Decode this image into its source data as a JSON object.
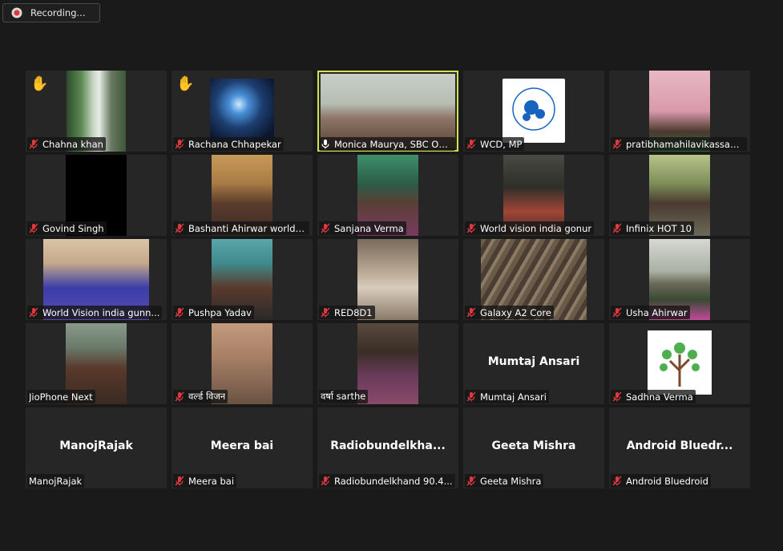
{
  "recording": {
    "label": "Recording...",
    "icon": "recording-icon"
  },
  "colors": {
    "background": "#1a1a1a",
    "tile": "#262626",
    "active_border": "#d4e157",
    "muted_icon": "#e0383e"
  },
  "participants": [
    {
      "name": "Chahna khan",
      "muted": true,
      "raised_hand": true
    },
    {
      "name": "Rachana Chhapekar",
      "muted": true,
      "raised_hand": true
    },
    {
      "name": "Monica Maurya, SBC Off...",
      "muted": false,
      "speaking": true,
      "active": true
    },
    {
      "name": "WCD, MP",
      "muted": true
    },
    {
      "name": "pratibhamahilavikassami...",
      "muted": true
    },
    {
      "name": "Govind Singh",
      "muted": true
    },
    {
      "name": "Bashanti Ahirwar world ...",
      "muted": true
    },
    {
      "name": "Sanjana Verma",
      "muted": true
    },
    {
      "name": "World vision india gonur",
      "muted": true
    },
    {
      "name": "Infinix HOT 10",
      "muted": true
    },
    {
      "name": "World Vision india gunn...",
      "muted": true
    },
    {
      "name": "Pushpa Yadav",
      "muted": true
    },
    {
      "name": "RED8D1",
      "muted": true
    },
    {
      "name": "Galaxy A2 Core",
      "muted": true
    },
    {
      "name": "Usha Ahirwar",
      "muted": true
    },
    {
      "name": "JioPhone Next",
      "muted": false
    },
    {
      "name": "वर्ल्ड विजन",
      "muted": true
    },
    {
      "name": "वर्षा sarthe",
      "muted": false
    },
    {
      "name": "Mumtaj Ansari",
      "display_name": "Mumtaj Ansari",
      "muted": true
    },
    {
      "name": "Sadhna Verma",
      "muted": true
    },
    {
      "name": "ManojRajak",
      "display_name": "ManojRajak",
      "muted": false
    },
    {
      "name": "Meera bai",
      "display_name": "Meera bai",
      "muted": true
    },
    {
      "name": "Radiobundelkhand 90.4...",
      "display_name": "Radiobundelkhа...",
      "muted": true
    },
    {
      "name": "Geeta Mishra",
      "display_name": "Geeta Mishra",
      "muted": true
    },
    {
      "name": "Android Bluedroid",
      "display_name": "Android  Bluedr...",
      "muted": true
    }
  ]
}
